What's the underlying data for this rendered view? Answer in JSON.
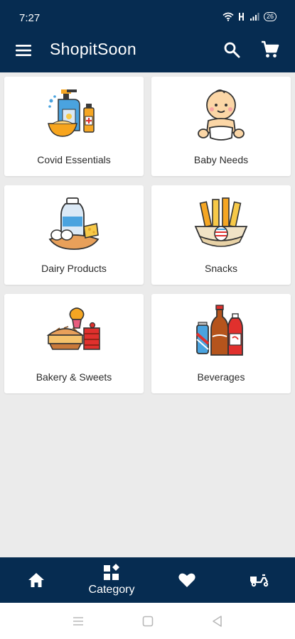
{
  "status_bar": {
    "time": "7:27",
    "battery": "26",
    "icons": [
      "wifi-icon",
      "signal-hd-icon",
      "cell-signal-icon",
      "battery-icon"
    ]
  },
  "app_bar": {
    "title": "ShopitSoon",
    "icons": [
      "menu-icon",
      "search-icon",
      "cart-icon"
    ]
  },
  "categories": [
    {
      "label": "Covid Essentials",
      "icon": "sanitizer-icon"
    },
    {
      "label": "Baby Needs",
      "icon": "baby-icon"
    },
    {
      "label": "Dairy Products",
      "icon": "dairy-icon"
    },
    {
      "label": "Snacks",
      "icon": "snacks-icon"
    },
    {
      "label": "Bakery & Sweets",
      "icon": "bakery-icon"
    },
    {
      "label": "Beverages",
      "icon": "beverages-icon"
    }
  ],
  "bottom_nav": {
    "items": [
      {
        "icon": "home-icon",
        "label": ""
      },
      {
        "icon": "category-icon",
        "label": "Category"
      },
      {
        "icon": "heart-icon",
        "label": ""
      },
      {
        "icon": "delivery-scooter-icon",
        "label": ""
      }
    ]
  },
  "colors": {
    "primary": "#062c51",
    "background": "#ebebeb",
    "card": "#ffffff"
  }
}
